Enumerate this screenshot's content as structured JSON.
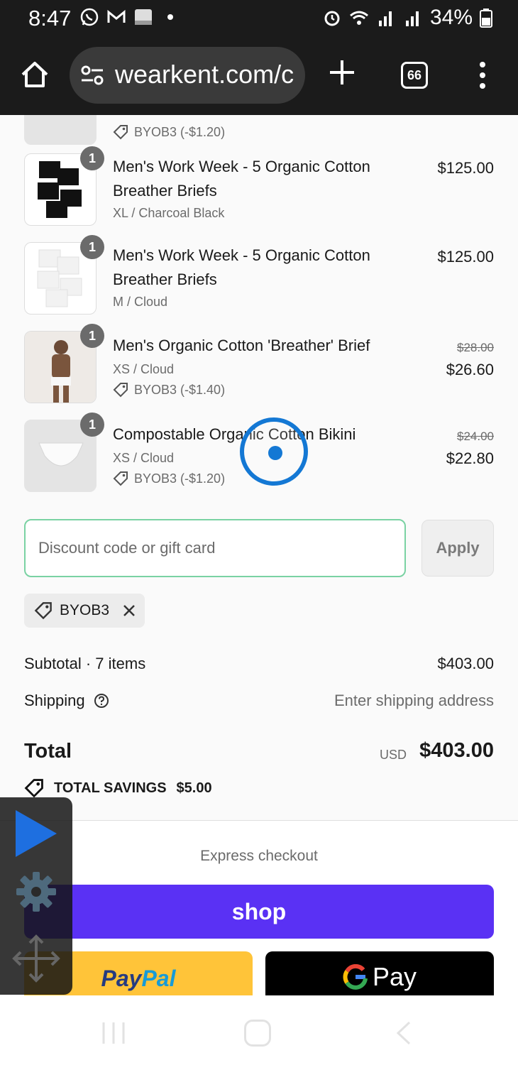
{
  "status_bar": {
    "time": "8:47",
    "battery": "34%"
  },
  "browser": {
    "url": "wearkent.com/c",
    "tab_count": "66"
  },
  "cart": {
    "partial_item": {
      "discount": "BYOB3 (-$1.20)"
    },
    "items": [
      {
        "qty": "1",
        "name": "Men's Work Week - 5 Organic Cotton Breather Briefs",
        "variant": "XL / Charcoal Black",
        "price": "$125.00"
      },
      {
        "qty": "1",
        "name": "Men's Work Week - 5 Organic Cotton Breather Briefs",
        "variant": "M / Cloud",
        "price": "$125.00"
      },
      {
        "qty": "1",
        "name": "Men's Organic Cotton 'Breather' Brief",
        "variant": "XS / Cloud",
        "discount": "BYOB3 (-$1.40)",
        "original_price": "$28.00",
        "price": "$26.60"
      },
      {
        "qty": "1",
        "name": "Compostable Organic Cotton Bikini",
        "variant": "XS / Cloud",
        "discount": "BYOB3 (-$1.20)",
        "original_price": "$24.00",
        "price": "$22.80"
      }
    ]
  },
  "discount_form": {
    "placeholder": "Discount code or gift card",
    "apply_label": "Apply",
    "applied_code": "BYOB3"
  },
  "summary": {
    "subtotal_label": "Subtotal · 7 items",
    "subtotal_value": "$403.00",
    "shipping_label": "Shipping",
    "shipping_value": "Enter shipping address",
    "total_label": "Total",
    "total_currency": "USD",
    "total_value": "$403.00",
    "savings_label": "TOTAL SAVINGS",
    "savings_value": "$5.00"
  },
  "checkout": {
    "express_label": "Express checkout",
    "shop_label": "shop",
    "paypal_part1": "Pay",
    "paypal_part2": "Pal",
    "gpay_label": "Pay"
  },
  "colors": {
    "focus_border": "#7ad2a3",
    "shop_purple": "#5a31f4",
    "paypal_yellow": "#ffc439",
    "tap_blue": "#1478d4"
  }
}
